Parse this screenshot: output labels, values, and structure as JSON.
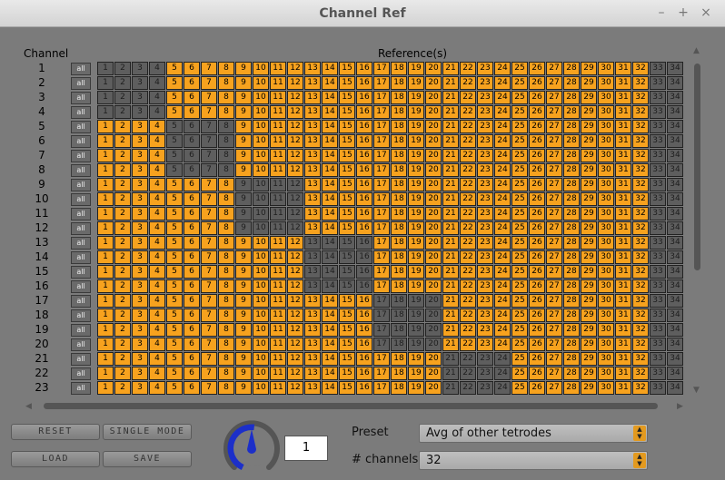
{
  "window": {
    "title": "Channel Ref",
    "minimize": "–",
    "maximize": "+",
    "close": "×"
  },
  "headers": {
    "channel": "Channel",
    "references": "Reference(s)"
  },
  "grid": {
    "row_labels": [
      "1",
      "2",
      "3",
      "4",
      "5",
      "6",
      "7",
      "8",
      "9",
      "10",
      "11",
      "12",
      "13",
      "14",
      "15",
      "16",
      "17",
      "18",
      "19",
      "20",
      "21",
      "22",
      "23"
    ],
    "col_labels": [
      "1",
      "2",
      "3",
      "4",
      "5",
      "6",
      "7",
      "8",
      "9",
      "10",
      "11",
      "12",
      "13",
      "14",
      "15",
      "16",
      "17",
      "18",
      "19",
      "20",
      "21",
      "22",
      "23",
      "24",
      "25",
      "26",
      "27",
      "28",
      "29",
      "30",
      "31",
      "32",
      "33",
      "34"
    ],
    "all_label": "all",
    "colors": {
      "on": "#f7a21e",
      "off": "#5e5e5e"
    },
    "off_ranges": [
      [
        1,
        4
      ],
      [
        1,
        4
      ],
      [
        1,
        4
      ],
      [
        1,
        4
      ],
      [
        5,
        8
      ],
      [
        5,
        8
      ],
      [
        5,
        8
      ],
      [
        5,
        8
      ],
      [
        9,
        12
      ],
      [
        9,
        12
      ],
      [
        9,
        12
      ],
      [
        9,
        12
      ],
      [
        13,
        16
      ],
      [
        13,
        16
      ],
      [
        13,
        16
      ],
      [
        13,
        16
      ],
      [
        17,
        20
      ],
      [
        17,
        20
      ],
      [
        17,
        20
      ],
      [
        17,
        20
      ],
      [
        21,
        24
      ],
      [
        21,
        24
      ],
      [
        21,
        24
      ]
    ],
    "always_off": [
      33,
      34
    ]
  },
  "buttons": {
    "reset": "RESET",
    "single_mode": "SINGLE MODE",
    "load": "LOAD",
    "save": "SAVE"
  },
  "dial": {
    "value": "1"
  },
  "preset": {
    "label": "Preset",
    "value": "Avg of other tetrodes"
  },
  "channels": {
    "label": "# channels",
    "value": "32"
  }
}
